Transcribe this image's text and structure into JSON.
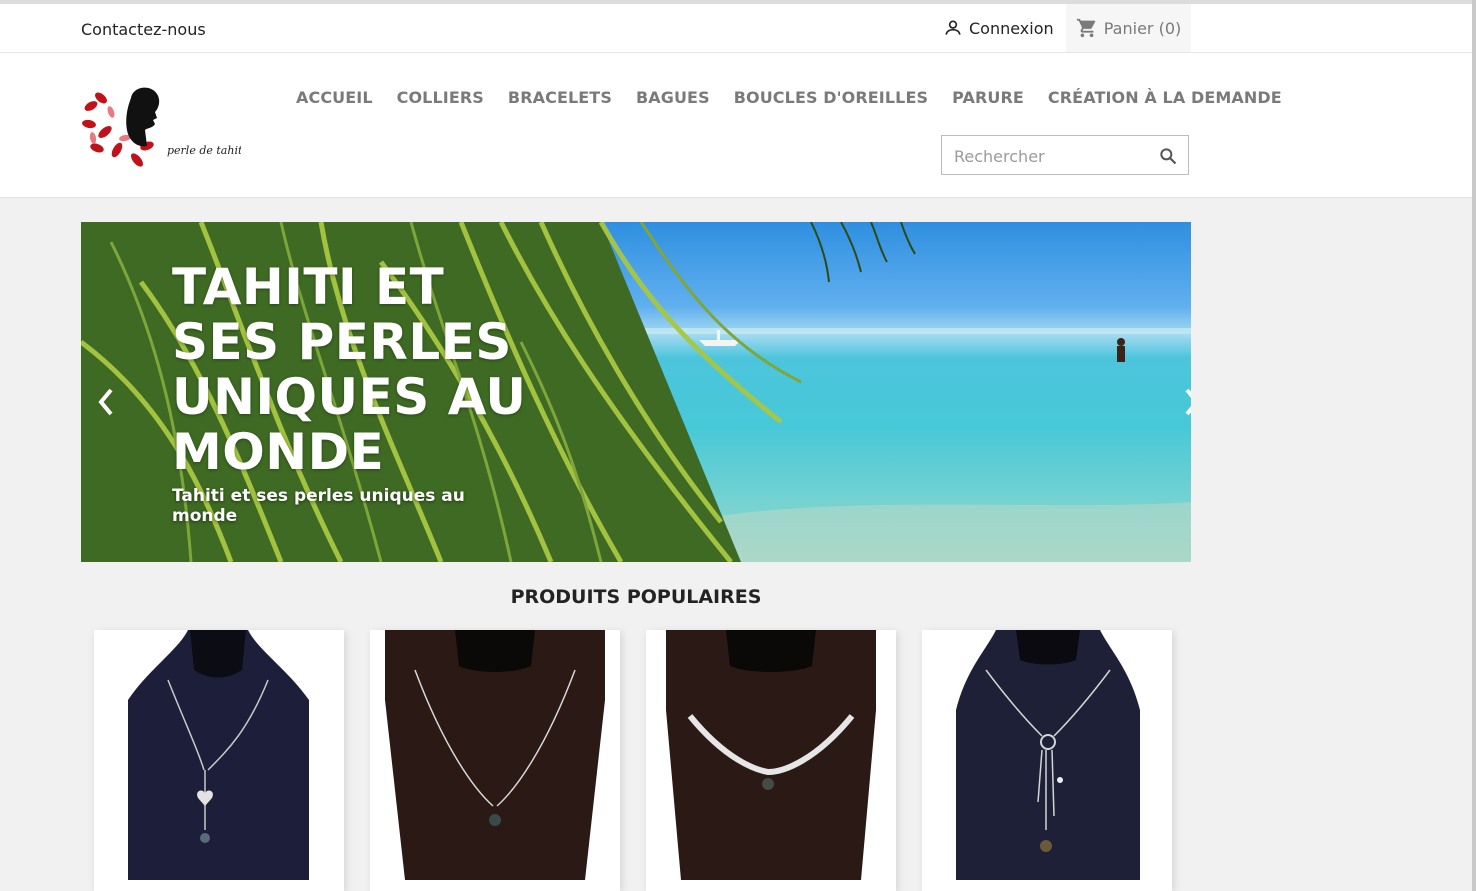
{
  "header": {
    "contact_label": "Contactez-nous",
    "login_label": "Connexion",
    "cart_label": "Panier (0)"
  },
  "logo": {
    "tagline": "perle de tahiti"
  },
  "menu": {
    "items": [
      "ACCUEIL",
      "COLLIERS",
      "BRACELETS",
      "BAGUES",
      "BOUCLES D'OREILLES",
      "PARURE",
      "CRÉATION À LA DEMANDE"
    ]
  },
  "search": {
    "placeholder": "Rechercher"
  },
  "slider": {
    "title": "TAHITI ET SES PERLES UNIQUES AU MONDE",
    "subtitle": "Tahiti et ses perles uniques au monde"
  },
  "featured": {
    "title": "PRODUITS POPULAIRES"
  },
  "products": [
    {
      "image": "necklace-heart-pendant",
      "bg": "#1d1f3a"
    },
    {
      "image": "necklace-single-pearl",
      "bg": "#2a1915"
    },
    {
      "image": "necklace-torque-pearl",
      "bg": "#2b1915"
    },
    {
      "image": "necklace-ring-tassel",
      "bg": "#1e2038"
    }
  ],
  "colors": {
    "menu": "#7a7a7a",
    "cart_bg": "#f6f6f6",
    "page_bg": "#f1f1f1"
  }
}
